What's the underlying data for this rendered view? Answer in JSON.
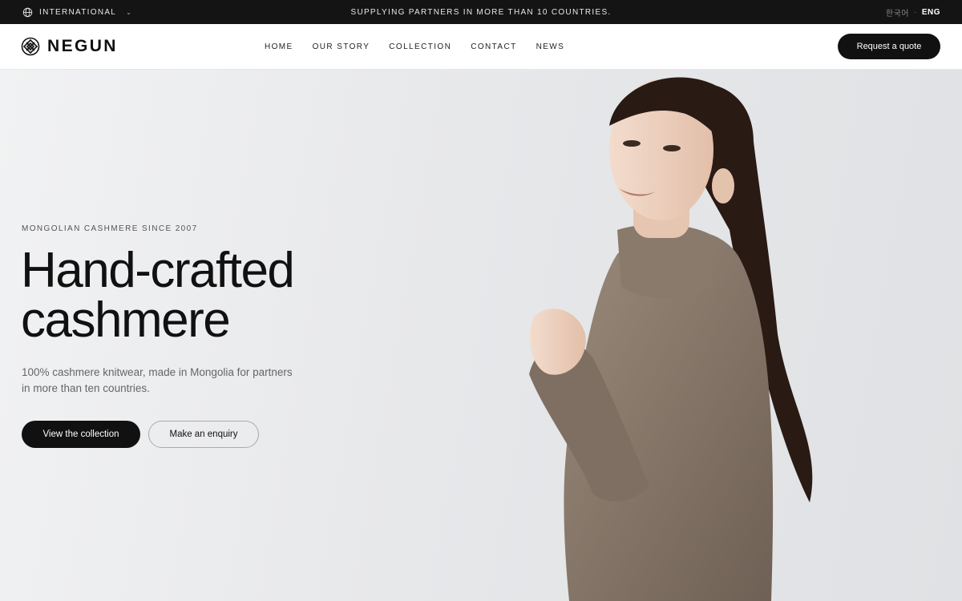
{
  "topbar": {
    "region_label": "INTERNATIONAL",
    "announcement": "SUPPLYING PARTNERS IN MORE THAN 10 COUNTRIES.",
    "lang_ko": "한국어",
    "lang_sep": "·",
    "lang_en": "ENG",
    "icons": {
      "region": "globe-icon",
      "dropdown": "chevron-down-icon"
    }
  },
  "header": {
    "brand": "NEGUN",
    "logo_icon": "knot-logo-icon",
    "nav": [
      {
        "label": "HOME"
      },
      {
        "label": "OUR STORY"
      },
      {
        "label": "COLLECTION"
      },
      {
        "label": "CONTACT"
      },
      {
        "label": "NEWS"
      }
    ],
    "cta": "Request a quote"
  },
  "hero": {
    "eyebrow": "MONGOLIAN CASHMERE SINCE 2007",
    "title_line1": "Hand-crafted",
    "title_line2": "cashmere",
    "lede_line1": "100% cashmere knitwear, made in Mongolia for partners",
    "lede_line2": "in more than ten countries.",
    "primary_button": "View the collection",
    "secondary_button": "Make an enquiry"
  },
  "colors": {
    "topbar_bg": "#141414",
    "ink": "#111111",
    "hero_bg": "#e7e8ea",
    "sweater": "#8b7b6d",
    "hair": "#2a1a14"
  }
}
